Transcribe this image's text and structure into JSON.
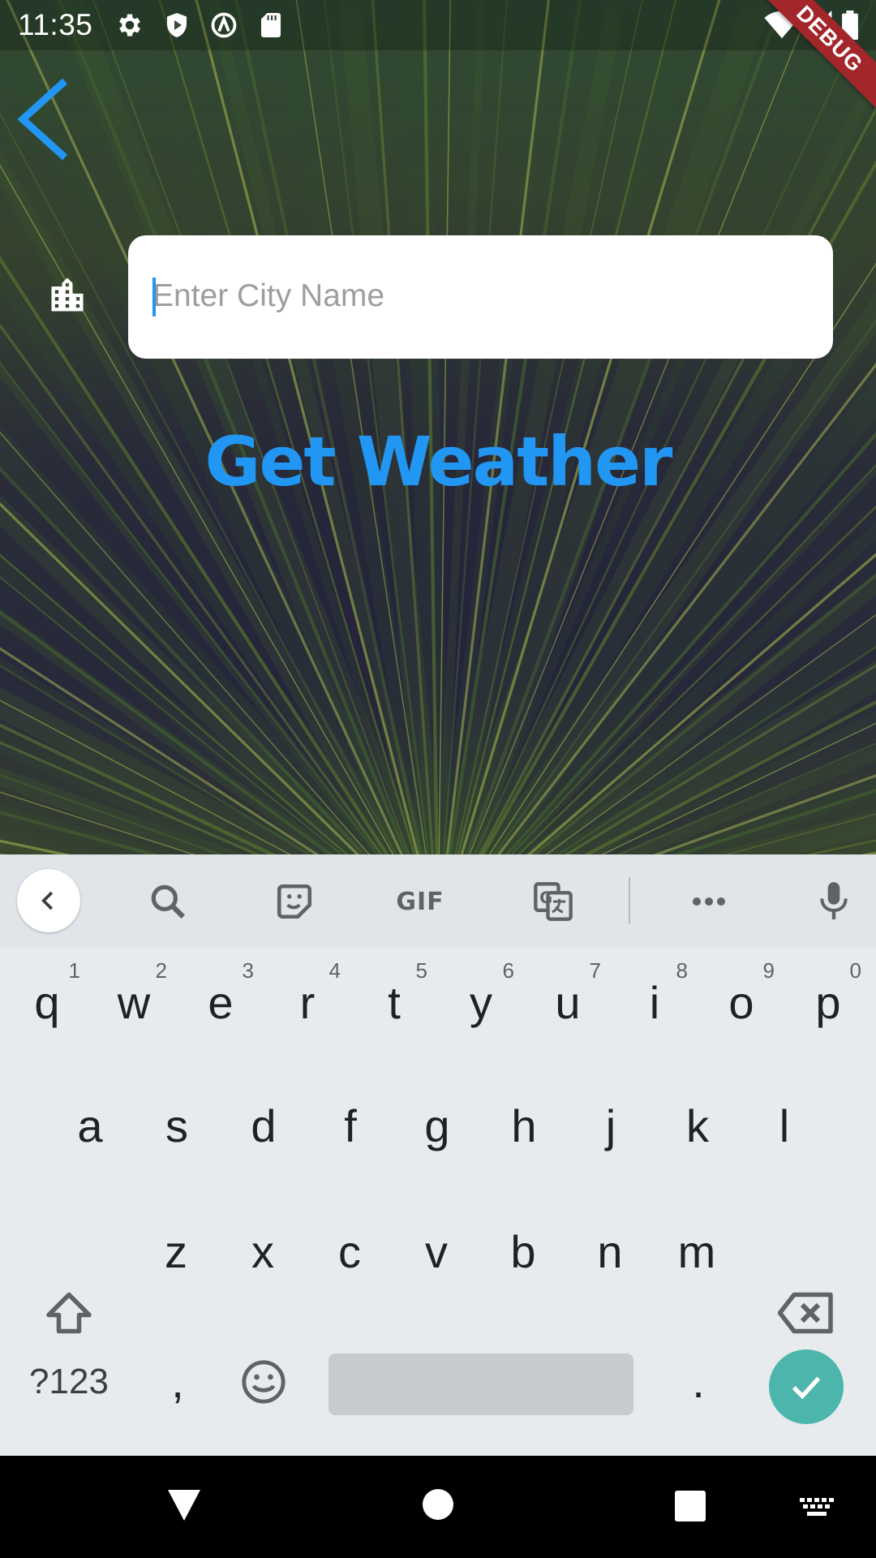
{
  "status_bar": {
    "time": "11:35",
    "left_icons": [
      "settings-icon",
      "shield-icon",
      "at-sign-icon",
      "sd-card-icon"
    ],
    "right_icons": [
      "wifi-icon",
      "signal-icon",
      "battery-icon"
    ],
    "debug_label": "DEBUG"
  },
  "app": {
    "back_icon": "chevron-left-icon",
    "city_icon": "building-icon",
    "city_input": {
      "value": "",
      "placeholder": "Enter City Name"
    },
    "action_label": "Get Weather",
    "accent_color": "#2196f3"
  },
  "keyboard": {
    "toolbar": {
      "items": [
        "chevron-left-icon",
        "search-icon",
        "sticker-icon",
        "GIF",
        "translate-icon",
        "more-icon",
        "mic-icon"
      ],
      "gif_label": "GIF"
    },
    "row1": [
      {
        "key": "q",
        "hint": "1"
      },
      {
        "key": "w",
        "hint": "2"
      },
      {
        "key": "e",
        "hint": "3"
      },
      {
        "key": "r",
        "hint": "4"
      },
      {
        "key": "t",
        "hint": "5"
      },
      {
        "key": "y",
        "hint": "6"
      },
      {
        "key": "u",
        "hint": "7"
      },
      {
        "key": "i",
        "hint": "8"
      },
      {
        "key": "o",
        "hint": "9"
      },
      {
        "key": "p",
        "hint": "0"
      }
    ],
    "row2": [
      "a",
      "s",
      "d",
      "f",
      "g",
      "h",
      "j",
      "k",
      "l"
    ],
    "row3": [
      "z",
      "x",
      "c",
      "v",
      "b",
      "n",
      "m"
    ],
    "bottom": {
      "symbols_label": "?123",
      "comma": ",",
      "period": ".",
      "emoji_icon": "emoji-icon",
      "enter_icon": "check-icon",
      "enter_color": "#4db6ac"
    }
  },
  "nav_bar": {
    "buttons": [
      "back-triangle-icon",
      "home-circle-icon",
      "recents-square-icon",
      "keyboard-switch-icon"
    ]
  }
}
